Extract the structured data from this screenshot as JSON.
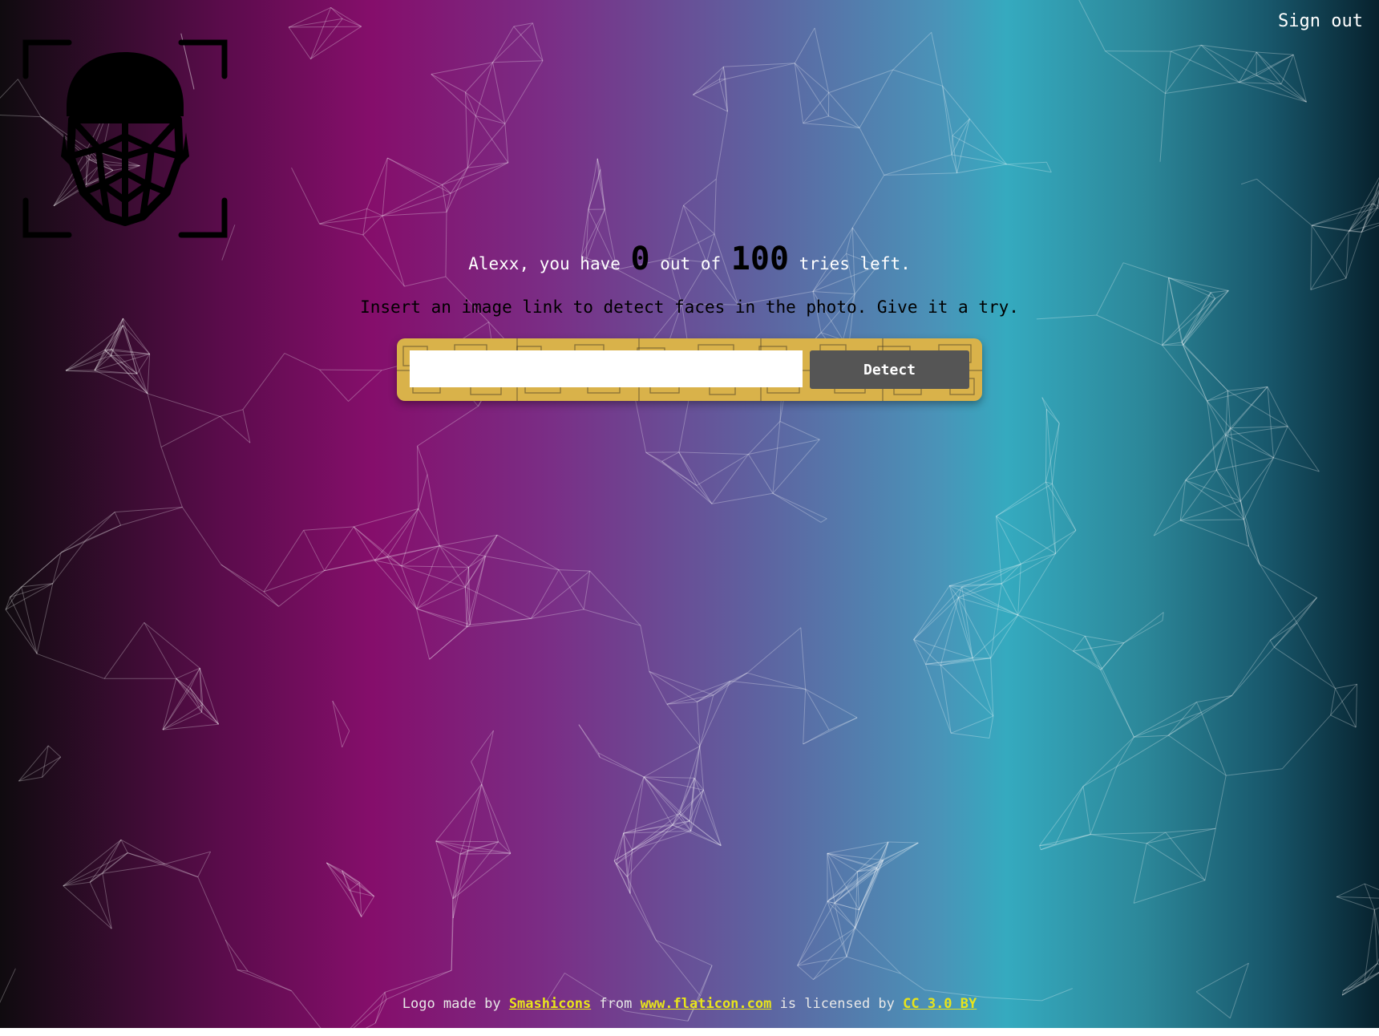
{
  "nav": {
    "signout_label": "Sign out"
  },
  "logo": {
    "icon": "face-recognition-icon"
  },
  "rank": {
    "prefix": "Alexx, you have ",
    "remaining": "0",
    "middle": " out of ",
    "total": "100",
    "suffix": " tries left."
  },
  "hint": "Insert an image link to detect faces in the photo. Give it a try.",
  "form": {
    "input_value": "",
    "detect_label": "Detect"
  },
  "footer": {
    "t1": "Logo made by ",
    "link1": "Smashicons",
    "t2": " from ",
    "link2": "www.flaticon.com",
    "t3": " is licensed by ",
    "link3": "CC 3.0 BY"
  },
  "colors": {
    "accent_form": "#d9b24a",
    "button": "#555555",
    "link": "#e8e41a",
    "gradient": [
      "#0f0b0f",
      "#850e6b",
      "#35aabf",
      "#07212d"
    ]
  }
}
